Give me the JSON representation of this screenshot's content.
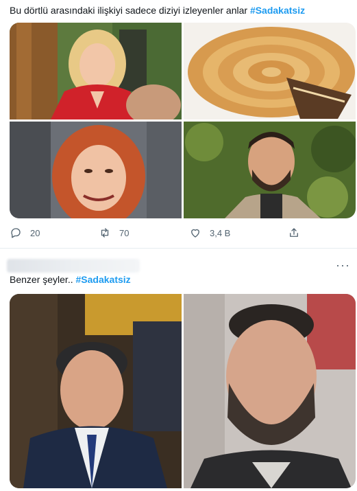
{
  "tweet1": {
    "text": "Bu dörtlü arasındaki ilişkiyi sadece diziyi izleyenler anlar ",
    "hashtag": "#Sadakatsiz",
    "images": [
      "woman-red-dress-photo",
      "spiral-pastry-photo",
      "red-haired-woman-photo",
      "bearded-man-photo"
    ],
    "actions": {
      "replies": "20",
      "retweets": "70",
      "likes": "3,4 B"
    }
  },
  "tweet2": {
    "more_label": "···",
    "text": "Benzer şeyler.. ",
    "hashtag": "#Sadakatsiz",
    "images": [
      "man-in-suit-photo",
      "crying-bearded-man-photo"
    ]
  },
  "colors": {
    "hashtag": "#1d9bf0",
    "muted": "#536471",
    "divider": "#e6ecf0"
  }
}
